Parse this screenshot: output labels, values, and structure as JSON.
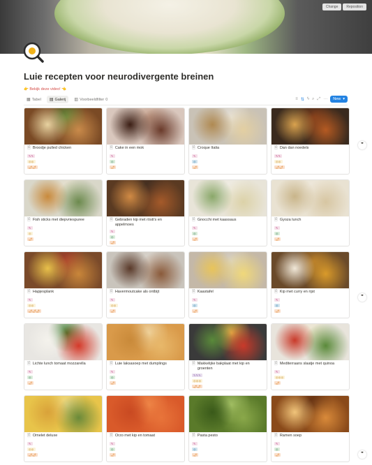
{
  "cover": {
    "buttons": [
      "Change",
      "Reposition"
    ]
  },
  "page": {
    "title": "Luie recepten voor neurodivergente breinen",
    "subtitle": "👉 Bekijk deze video! 👈"
  },
  "views": {
    "tabs": [
      {
        "label": "Tabel",
        "icon": "table-icon",
        "active": false
      },
      {
        "label": "Galerij",
        "icon": "gallery-icon",
        "active": true
      },
      {
        "label": "Voorbeeldfilter",
        "icon": "filter-view-icon",
        "active": false
      }
    ],
    "filter_count": "0",
    "new_label": "New"
  },
  "cards": [
    {
      "title": "Broodje pulled chicken",
      "tags": [
        [
          "✎✎",
          "pink"
        ],
        [
          "◎◎",
          "yellow"
        ],
        [
          "🌶🌶",
          "orange"
        ]
      ],
      "img": [
        "#7a4a25",
        "#c98a4a",
        "#e7d2a0",
        "#5a8a3a"
      ]
    },
    {
      "title": "Cake in een mok",
      "tags": [
        [
          "✎",
          "pink"
        ],
        [
          "◎",
          "green"
        ],
        [
          "🌶",
          "orange"
        ]
      ],
      "img": [
        "#d9c7bd",
        "#6a3a2a",
        "#3b1e14",
        "#c9a590"
      ]
    },
    {
      "title": "Croque Italia",
      "tags": [
        [
          "✎",
          "pink"
        ],
        [
          "◎",
          "blue"
        ],
        [
          "🌶",
          "orange"
        ]
      ],
      "img": [
        "#c9c2b6",
        "#e3cfa2",
        "#b08a52",
        "#e8e4dc"
      ]
    },
    {
      "title": "Dan dan noedels",
      "tags": [
        [
          "✎✎",
          "pink"
        ],
        [
          "◎◎",
          "yellow"
        ],
        [
          "🌶🌶",
          "orange"
        ]
      ],
      "img": [
        "#3a2a1e",
        "#b55a22",
        "#d9a24e",
        "#7a3a1a"
      ]
    },
    {
      "title": "Fish sticks met diepvriespuree",
      "tags": [
        [
          "✎",
          "pink"
        ],
        [
          "◎",
          "yellow"
        ],
        [
          "🌶",
          "orange"
        ]
      ],
      "img": [
        "#d9d7c9",
        "#6c8a4e",
        "#c98a3c",
        "#e8e2d0"
      ]
    },
    {
      "title": "Gebraden kip met rösti's en appelmoes",
      "tags": [
        [
          "✎",
          "pink"
        ],
        [
          "◎",
          "green"
        ],
        [
          "🌶",
          "orange"
        ]
      ],
      "img": [
        "#5a3a22",
        "#a55a2a",
        "#d08a44",
        "#3a2a20"
      ]
    },
    {
      "title": "Gnocchi met kaassaus",
      "tags": [
        [
          "✎",
          "pink"
        ],
        [
          "◎",
          "green"
        ],
        [
          "🌶",
          "orange"
        ]
      ],
      "img": [
        "#e8e4d8",
        "#dcd2a8",
        "#8aa86a",
        "#f1eee6"
      ]
    },
    {
      "title": "Gyoza lunch",
      "tags": [
        [
          "✎",
          "pink"
        ],
        [
          "◎",
          "green"
        ],
        [
          "🌶",
          "orange"
        ]
      ],
      "img": [
        "#e9e2d2",
        "#d7c6a2",
        "#c9b58a",
        "#efe9dd"
      ]
    },
    {
      "title": "Hapjesplank",
      "tags": [
        [
          "✎",
          "pink"
        ],
        [
          "◎◎",
          "yellow"
        ],
        [
          "🌶🌶🌶",
          "orange"
        ]
      ],
      "img": [
        "#7a4a2a",
        "#c9863a",
        "#e8c04a",
        "#a83a2a"
      ]
    },
    {
      "title": "Havermoutcake als ontbijt",
      "tags": [
        [
          "✎",
          "pink"
        ],
        [
          "◎◎",
          "yellow"
        ],
        [
          "🌶",
          "orange"
        ]
      ],
      "img": [
        "#c9c4bc",
        "#8a5a3a",
        "#5a3a2a",
        "#ddd8d0"
      ]
    },
    {
      "title": "Kaastafel",
      "tags": [
        [
          "✎",
          "pink"
        ],
        [
          "◎",
          "blue"
        ],
        [
          "🌶",
          "orange"
        ]
      ],
      "img": [
        "#c4b8a8",
        "#f0d87a",
        "#e8c45a",
        "#d8d2c6"
      ]
    },
    {
      "title": "Kip met curry en rijst",
      "tags": [
        [
          "✎",
          "pink"
        ],
        [
          "◎",
          "blue"
        ],
        [
          "🌶",
          "orange"
        ]
      ],
      "img": [
        "#6a4a2a",
        "#d99a2a",
        "#f1e8d8",
        "#b0782a"
      ]
    },
    {
      "title": "Lichte lunch tomaat mozzarella",
      "tags": [
        [
          "✎",
          "pink"
        ],
        [
          "◎",
          "green"
        ],
        [
          "🌶",
          "orange"
        ]
      ],
      "img": [
        "#e8e6e2",
        "#d43a2a",
        "#f4f2ec",
        "#3a7a2a"
      ]
    },
    {
      "title": "Luie laksasoep met dumplings",
      "tags": [
        [
          "✎",
          "pink"
        ],
        [
          "◎",
          "green"
        ],
        [
          "🌶",
          "orange"
        ]
      ],
      "img": [
        "#d99a4a",
        "#e8b86a",
        "#c98a3a",
        "#f0d8a8"
      ]
    },
    {
      "title": "Makkelijke bakplaat met kip en groenten",
      "tags": [
        [
          "✎✎✎",
          "purple"
        ],
        [
          "◎◎◎",
          "yellow"
        ],
        [
          "🌶🌶",
          "orange"
        ]
      ],
      "img": [
        "#3a3a3a",
        "#c93a2a",
        "#5a8a3a",
        "#e8c44a"
      ]
    },
    {
      "title": "Mediterraans slaatje met quinoa",
      "tags": [
        [
          "✎",
          "pink"
        ],
        [
          "◎◎◎",
          "yellow"
        ],
        [
          "🌶",
          "orange"
        ]
      ],
      "img": [
        "#e8e4dc",
        "#5a8a3a",
        "#c93a2a",
        "#f0e8d0"
      ]
    },
    {
      "title": "Omelet deluxe",
      "tags": [
        [
          "✎",
          "pink"
        ],
        [
          "◎◎",
          "yellow"
        ],
        [
          "🌶🌶",
          "orange"
        ]
      ],
      "img": [
        "#e8c44a",
        "#6a8a3a",
        "#d9a23a",
        "#f0dc8a"
      ]
    },
    {
      "title": "Orzo met kip en tomaat",
      "tags": [
        [
          "✎",
          "pink"
        ],
        [
          "◎",
          "green"
        ],
        [
          "🌶",
          "orange"
        ]
      ],
      "img": [
        "#d95a2a",
        "#e8743a",
        "#c94a22",
        "#f08a4a"
      ]
    },
    {
      "title": "Pasta pesto",
      "tags": [
        [
          "✎",
          "pink"
        ],
        [
          "◎",
          "blue"
        ],
        [
          "🌶",
          "orange"
        ]
      ],
      "img": [
        "#5a7a2a",
        "#8aa84a",
        "#3a5a1a",
        "#a8c46a"
      ]
    },
    {
      "title": "Ramen soep",
      "tags": [
        [
          "✎",
          "pink"
        ],
        [
          "◎",
          "green"
        ],
        [
          "🌶",
          "orange"
        ]
      ],
      "img": [
        "#8a4a1a",
        "#d98a3a",
        "#f0c47a",
        "#5a2a10"
      ]
    }
  ],
  "side_icons": [
    "comment-icon",
    "comment-icon",
    "comment-icon"
  ]
}
